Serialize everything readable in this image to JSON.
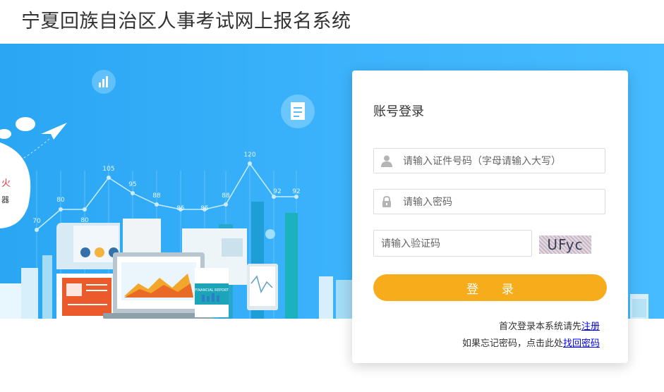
{
  "header": {
    "title": "宁夏回族自治区人事考试网上报名系统"
  },
  "banner": {
    "chart_points": [
      "70",
      "80",
      "80",
      "105",
      "95",
      "88",
      "85",
      "85",
      "88",
      "120",
      "92",
      "92"
    ],
    "report_label": "FINANCIAL REPORT",
    "side_text_1": "火",
    "side_text_2": "器"
  },
  "login": {
    "title": "账号登录",
    "username_placeholder": "请输入证件号码（字母请输入大写）",
    "password_placeholder": "请输入密码",
    "captcha_placeholder": "请输入验证码",
    "captcha_text": "UFyc",
    "submit_label": "登 录",
    "first_login_text": "首次登录本系统请先",
    "register_link": "注册",
    "forgot_text": "如果忘记密码，点击此处",
    "forgot_link": "找回密码"
  },
  "icons": {
    "user": "user-icon",
    "lock": "lock-icon",
    "chart": "bar-chart-icon",
    "document": "document-icon",
    "plane": "paper-plane-icon"
  },
  "colors": {
    "accent": "#f7ad1b",
    "banner": "#3bb2fb",
    "link": "#0000ee"
  }
}
